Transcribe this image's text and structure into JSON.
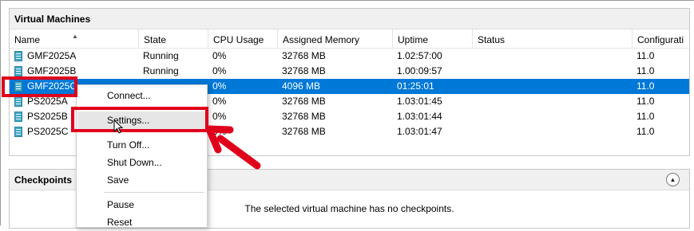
{
  "vm_panel": {
    "title": "Virtual Machines",
    "columns": [
      "Name",
      "State",
      "CPU Usage",
      "Assigned Memory",
      "Uptime",
      "Status",
      "Configurati"
    ],
    "rows": [
      {
        "name": "GMF2025A",
        "state": "Running",
        "cpu": "0%",
        "memory": "32768 MB",
        "uptime": "1.02:57:00",
        "status": "",
        "config": "11.0"
      },
      {
        "name": "GMF2025B",
        "state": "Running",
        "cpu": "0%",
        "memory": "32768 MB",
        "uptime": "1.00:09:57",
        "status": "",
        "config": "11.0"
      },
      {
        "name": "GMF2025C",
        "state": "",
        "cpu": "0%",
        "memory": "4096 MB",
        "uptime": "01:25:01",
        "status": "",
        "config": "11.0"
      },
      {
        "name": "PS2025A",
        "state": "",
        "cpu": "0%",
        "memory": "32768 MB",
        "uptime": "1.03:01:45",
        "status": "",
        "config": "11.0"
      },
      {
        "name": "PS2025B",
        "state": "",
        "cpu": "0%",
        "memory": "32768 MB",
        "uptime": "1.03:01:44",
        "status": "",
        "config": "11.0"
      },
      {
        "name": "PS2025C",
        "state": "",
        "cpu": "0%",
        "memory": "32768 MB",
        "uptime": "1.03:01:47",
        "status": "",
        "config": "11.0"
      }
    ],
    "selected_row": "GMF2025C"
  },
  "checkpoints": {
    "title": "Checkpoints",
    "message": "The selected virtual machine has no checkpoints."
  },
  "context_menu": {
    "items": [
      "Connect...",
      "Settings...",
      "Turn Off...",
      "Shut Down...",
      "Save",
      "Pause",
      "Reset"
    ],
    "hovered_item": "Settings..."
  },
  "colors": {
    "selection": "#0078d7",
    "highlight": "#e0001b",
    "vm_icon": "#43a9c8"
  },
  "icons": [
    "vm-icon",
    "sort-up-icon",
    "collapse-icon",
    "mouse-pointer-icon",
    "annotation-arrow"
  ]
}
